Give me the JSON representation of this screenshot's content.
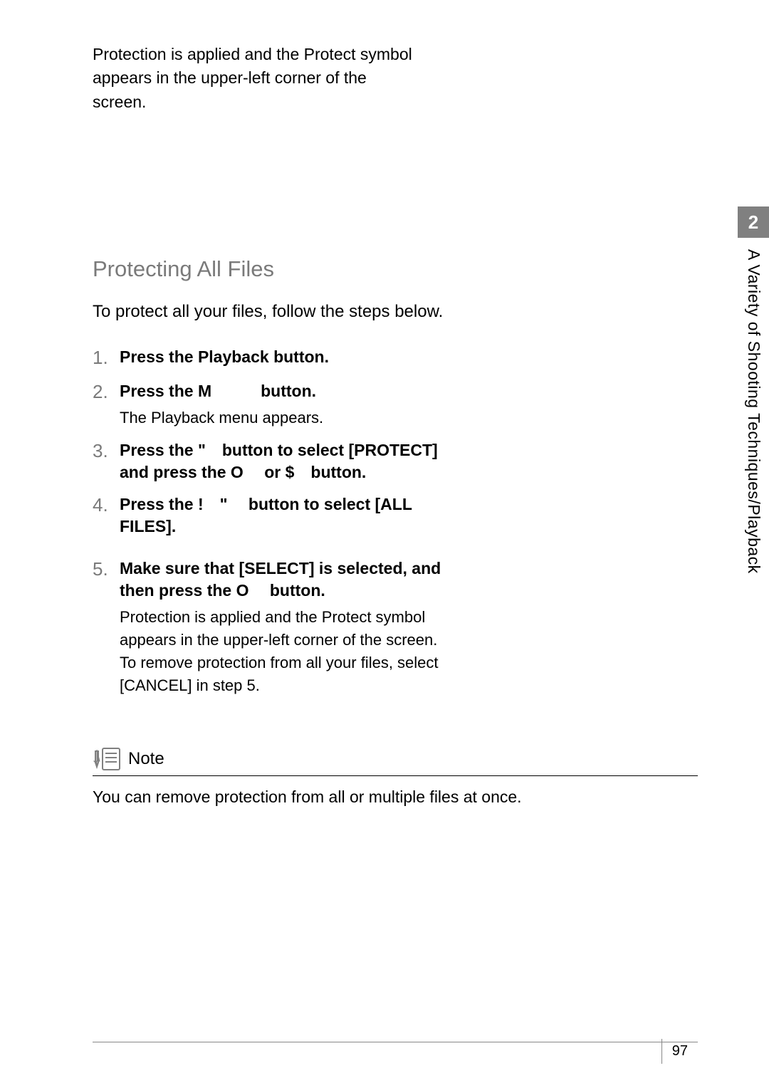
{
  "intro": "Protection is applied and the Protect symbol appears in the upper-left corner of the screen.",
  "chapter_tab": "2",
  "side_label": "A Variety of Shooting Techniques/Playback",
  "section": {
    "title": "Protecting All Files",
    "desc": "To protect all your files, follow the steps below."
  },
  "steps": [
    {
      "num": "1.",
      "title": "Press the Playback button.",
      "sub": ""
    },
    {
      "num": "2.",
      "title": "Press the M   button.",
      "sub": "The Playback menu appears."
    },
    {
      "num": "3.",
      "title": "Press the \" button to select [PROTECT] and press the O  or $ button.",
      "sub": ""
    },
    {
      "num": "4.",
      "title": "Press the ! \"  button to select [ALL FILES].",
      "sub": ""
    },
    {
      "num": "5.",
      "title": "Make sure that [SELECT] is selected, and then press the O  button.",
      "sub": "Protection is applied and the Protect symbol appears in the upper-left corner of the screen.\nTo remove protection from all your files, select [CANCEL] in step 5."
    }
  ],
  "note": {
    "label": "Note",
    "text": "You can remove protection from all or multiple files at once."
  },
  "page_number": "97"
}
